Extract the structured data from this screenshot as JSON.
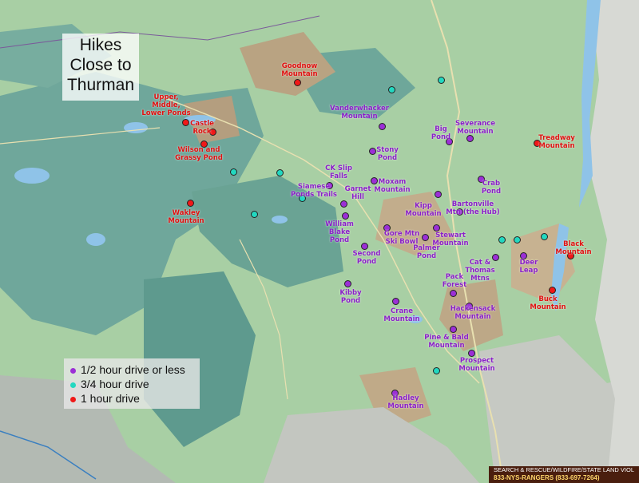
{
  "map": {
    "title_lines": [
      "Hikes",
      "Close to",
      "Thurman"
    ],
    "colors": {
      "half_hour": "#9b2fd6",
      "three_quarter": "#22d8c0",
      "one_hour": "#f01818",
      "water": "#8fc3e8",
      "forest_green": "#8cbf7a",
      "wilderness_teal": "#5f9c90",
      "footer_bg": "#4a1e0e"
    }
  },
  "legend": {
    "items": [
      {
        "label": "1/2 hour drive or less",
        "color": "#9b2fd6"
      },
      {
        "label": "3/4 hour drive",
        "color": "#22d8c0"
      },
      {
        "label": "1 hour drive",
        "color": "#f01818"
      }
    ]
  },
  "labels": {
    "goodnow": "Goodnow\nMountain",
    "upper_middle_lower": "Upper,\nMiddle,\nLower Ponds",
    "castle_rock": "Castle\nRock",
    "wilson_grassy": "Wilson and\nGrassy Pond",
    "wakley": "Wakley\nMountain",
    "vanderwhacker": "Vanderwhacker\nMountain",
    "stony_pond": "Stony\nPond",
    "ck_slip_falls": "CK Slip\nFalls",
    "moxam": "Moxam\nMountain",
    "big_pond": "Big\nPond",
    "severance": "Severance\nMountain",
    "treadway": "Treadway\nMountain",
    "crab_pond": "Crab\nPond",
    "siamese_ponds": "Siamese\nPonds Trails",
    "garnet_hill": "Garnet\nHill",
    "william_blake": "William\nBlake\nPond",
    "kipp": "Kipp\nMountain",
    "bartonville": "Bartonville\nMtn (the Hub)",
    "gore_ski_bowl": "Gore Mtn\nSki Bowl",
    "stewart": "Stewart\nMountain",
    "palmer_pond": "Palmer\nPond",
    "second_pond": "Second\nPond",
    "black_mountain": "Black\nMountain",
    "deer_leap": "Deer\nLeap",
    "cat_thomas": "Cat &\nThomas\nMtns",
    "pack_forest": "Pack\nForest",
    "kibby_pond": "Kibby\nPond",
    "buck_mountain": "Buck\nMountain",
    "crane": "Crane\nMountain",
    "hackensack": "Hackensack\nMountain",
    "pine_bald": "Pine & Bald\nMountain",
    "prospect": "Prospect\nMountain",
    "hadley": "Hadley\nMountain"
  },
  "footer": {
    "line1": "SEARCH & RESCUE/WILDFIRE/STATE LAND VIOL",
    "line2": "833-NYS-RANGERS (833-697-7264)"
  }
}
